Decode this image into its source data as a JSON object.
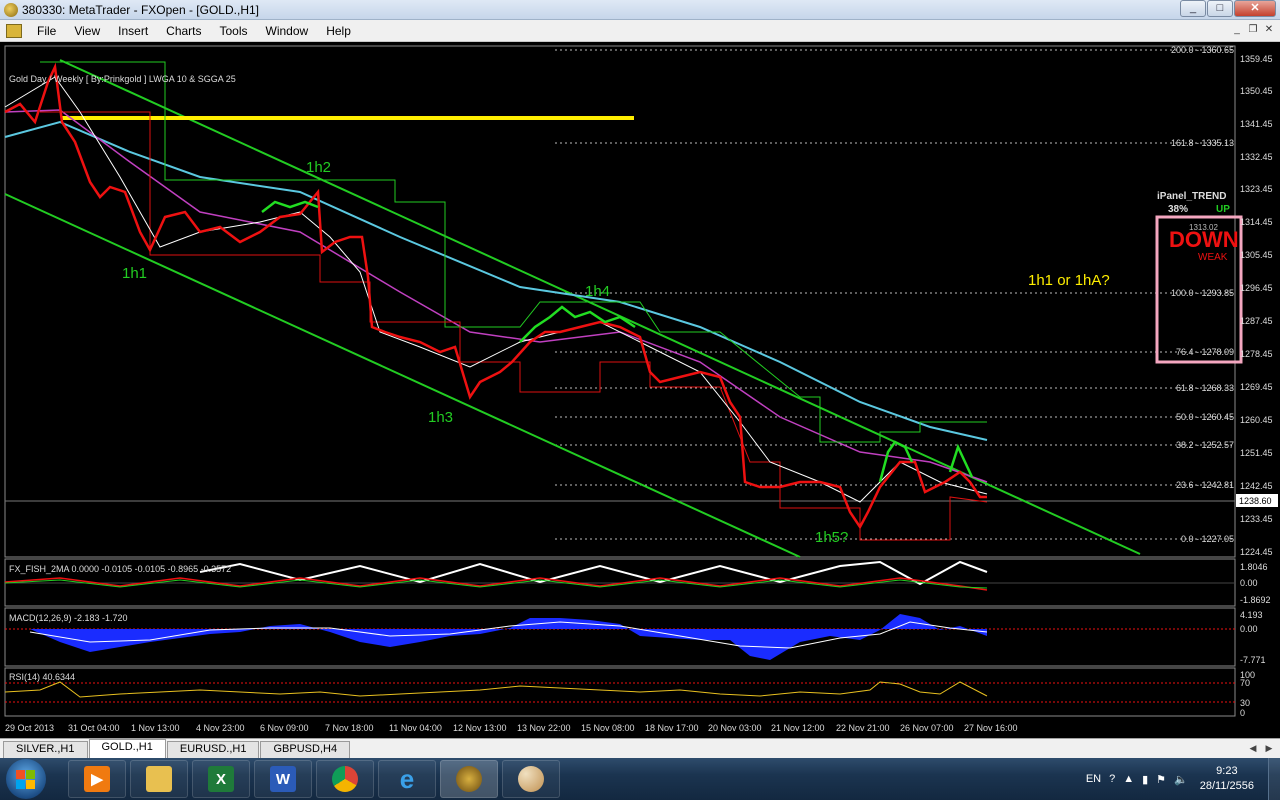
{
  "window": {
    "title": "380330: MetaTrader - FXOpen - [GOLD.,H1]",
    "controls": [
      "_",
      "□",
      "✕"
    ]
  },
  "menu": {
    "items": [
      "File",
      "View",
      "Insert",
      "Charts",
      "Tools",
      "Window",
      "Help"
    ],
    "mdi_controls": [
      "_",
      "❐",
      "✕"
    ]
  },
  "chart": {
    "header": "Gold Day / Weekly [ By:Prinkgold ]  LWGA 10  &  SGGA 25",
    "price_axis": [
      "1359.45",
      "1350.45",
      "1341.45",
      "1332.45",
      "1323.45",
      "1314.45",
      "1305.45",
      "1296.45",
      "1287.45",
      "1278.45",
      "1269.45",
      "1260.45",
      "1251.45",
      "1242.45",
      "1233.45",
      "1224.45"
    ],
    "current_price": "1238.60",
    "fib_levels": [
      "200.0 - 1360.65",
      "161.8 - 1335.13",
      "100.0 - 1293.85",
      "76.4 - 1278.09",
      "61.8 - 1268.33",
      "50.0 - 1260.45",
      "38.2 - 1252.57",
      "23.6 - 1242.81",
      "0.0 - 1227.05"
    ],
    "wave_labels": [
      "1h1",
      "1h2",
      "1h3",
      "1h4",
      "1h5?",
      "1h1 or 1hA?"
    ],
    "ipanel": {
      "title": "iPanel_TREND",
      "percent": "38%",
      "up": "UP",
      "main": "DOWN",
      "sub": "WEAK",
      "hidden_value": "1313.02"
    },
    "date_axis": [
      "29 Oct 2013",
      "31 Oct 04:00",
      "1 Nov 13:00",
      "4 Nov 23:00",
      "6 Nov 09:00",
      "7 Nov 18:00",
      "11 Nov 04:00",
      "12 Nov 13:00",
      "13 Nov 22:00",
      "15 Nov 08:00",
      "18 Nov 17:00",
      "20 Nov 03:00",
      "21 Nov 12:00",
      "22 Nov 21:00",
      "26 Nov 07:00",
      "27 Nov 16:00"
    ],
    "colors": {
      "bull": "#22dd22",
      "bear": "#ee1111",
      "channel": "#22cc22",
      "resistance": "#ffee00",
      "ma_cyan": "#5bc8e0",
      "ma_magenta": "#c040c0",
      "panel_border": "#f4a7c0"
    }
  },
  "indicators": {
    "fisher": {
      "label": "FX_FISH_2MA 0.0000 -0.0105 -0.0105 -0.8965 -0.3572",
      "scale": [
        "1.8046",
        "0.00",
        "-1.8692"
      ]
    },
    "macd": {
      "label": "MACD(12,26,9) -2.183 -1.720",
      "scale": [
        "4.193",
        "0.00",
        "-7.771"
      ]
    },
    "rsi": {
      "label": "RSI(14) 40.6344",
      "scale": [
        "100",
        "70",
        "30",
        "0"
      ]
    }
  },
  "tabs": [
    {
      "label": "SILVER.,H1",
      "active": false
    },
    {
      "label": "GOLD.,H1",
      "active": true
    },
    {
      "label": "EURUSD.,H1",
      "active": false
    },
    {
      "label": "GBPUSD,H4",
      "active": false
    }
  ],
  "taskbar": {
    "apps": [
      "media-player",
      "file-explorer",
      "excel",
      "word",
      "chrome",
      "internet-explorer",
      "metatrader",
      "paint"
    ],
    "language": "EN",
    "time": "9:23",
    "date": "28/11/2556"
  }
}
